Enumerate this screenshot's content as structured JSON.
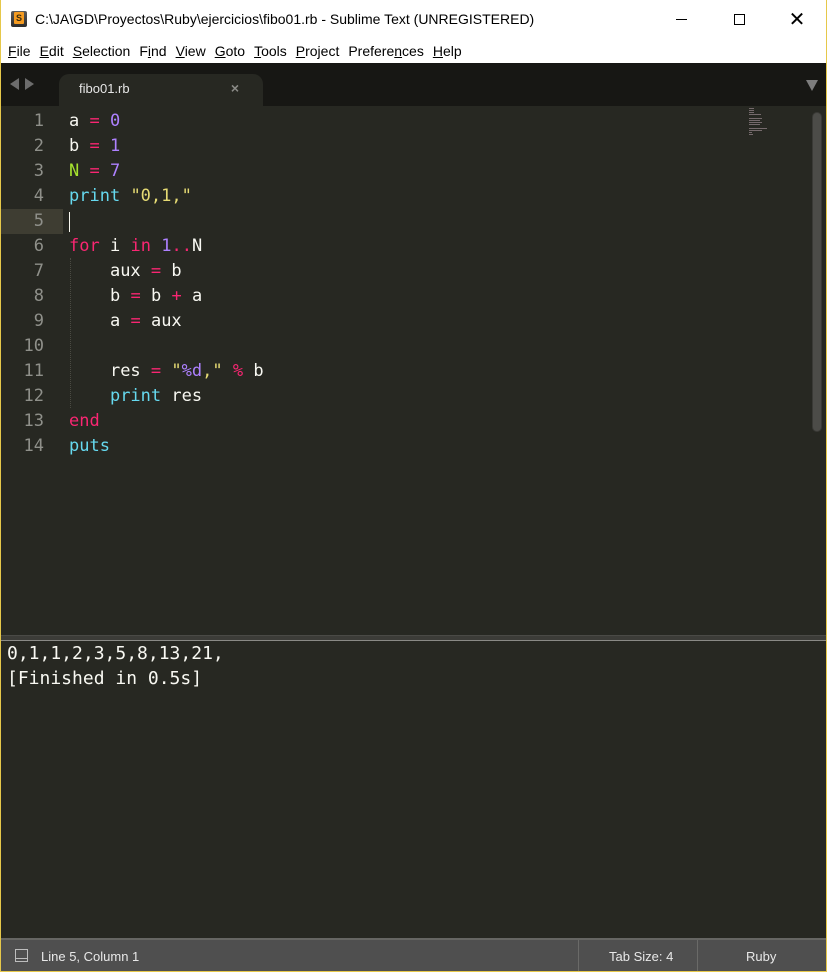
{
  "window": {
    "title": "C:\\JA\\GD\\Proyectos\\Ruby\\ejercicios\\fibo01.rb - Sublime Text (UNREGISTERED)",
    "app_icon_letter": "S",
    "controls": {
      "minimize": "minimize",
      "maximize": "maximize",
      "close": "✕"
    }
  },
  "menu": {
    "items": [
      {
        "label": "File",
        "accel": "F",
        "rest": "ile"
      },
      {
        "label": "Edit",
        "accel": "E",
        "rest": "dit"
      },
      {
        "label": "Selection",
        "accel": "S",
        "rest": "election"
      },
      {
        "label": "Find",
        "pre": "F",
        "accel": "i",
        "rest": "nd"
      },
      {
        "label": "View",
        "accel": "V",
        "rest": "iew"
      },
      {
        "label": "Goto",
        "accel": "G",
        "rest": "oto"
      },
      {
        "label": "Tools",
        "accel": "T",
        "rest": "ools"
      },
      {
        "label": "Project",
        "accel": "P",
        "rest": "roject"
      },
      {
        "label": "Preferences",
        "pre": "Prefere",
        "accel": "n",
        "rest": "ces"
      },
      {
        "label": "Help",
        "accel": "H",
        "rest": "elp"
      }
    ]
  },
  "tabs": {
    "active": {
      "label": "fibo01.rb",
      "close": "×"
    }
  },
  "editor": {
    "current_line": 5,
    "lines": [
      {
        "no": "1",
        "tokens": [
          [
            "var",
            "a"
          ],
          [
            "sp",
            " "
          ],
          [
            "op",
            "="
          ],
          [
            "sp",
            " "
          ],
          [
            "num",
            "0"
          ]
        ]
      },
      {
        "no": "2",
        "tokens": [
          [
            "var",
            "b"
          ],
          [
            "sp",
            " "
          ],
          [
            "op",
            "="
          ],
          [
            "sp",
            " "
          ],
          [
            "num",
            "1"
          ]
        ]
      },
      {
        "no": "3",
        "tokens": [
          [
            "const",
            "N"
          ],
          [
            "sp",
            " "
          ],
          [
            "op",
            "="
          ],
          [
            "sp",
            " "
          ],
          [
            "num",
            "7"
          ]
        ]
      },
      {
        "no": "4",
        "tokens": [
          [
            "fn",
            "print"
          ],
          [
            "sp",
            " "
          ],
          [
            "str",
            "\"0,1,\""
          ]
        ]
      },
      {
        "no": "5",
        "tokens": []
      },
      {
        "no": "6",
        "tokens": [
          [
            "kw",
            "for"
          ],
          [
            "sp",
            " "
          ],
          [
            "var",
            "i"
          ],
          [
            "sp",
            " "
          ],
          [
            "kw",
            "in"
          ],
          [
            "sp",
            " "
          ],
          [
            "num",
            "1"
          ],
          [
            "op",
            ".."
          ],
          [
            "var",
            "N"
          ]
        ]
      },
      {
        "no": "7",
        "tokens": [
          [
            "sp",
            "    "
          ],
          [
            "var",
            "aux"
          ],
          [
            "sp",
            " "
          ],
          [
            "op",
            "="
          ],
          [
            "sp",
            " "
          ],
          [
            "var",
            "b"
          ]
        ]
      },
      {
        "no": "8",
        "tokens": [
          [
            "sp",
            "    "
          ],
          [
            "var",
            "b"
          ],
          [
            "sp",
            " "
          ],
          [
            "op",
            "="
          ],
          [
            "sp",
            " "
          ],
          [
            "var",
            "b"
          ],
          [
            "sp",
            " "
          ],
          [
            "op",
            "+"
          ],
          [
            "sp",
            " "
          ],
          [
            "var",
            "a"
          ]
        ]
      },
      {
        "no": "9",
        "tokens": [
          [
            "sp",
            "    "
          ],
          [
            "var",
            "a"
          ],
          [
            "sp",
            " "
          ],
          [
            "op",
            "="
          ],
          [
            "sp",
            " "
          ],
          [
            "var",
            "aux"
          ]
        ]
      },
      {
        "no": "10",
        "tokens": []
      },
      {
        "no": "11",
        "tokens": [
          [
            "sp",
            "    "
          ],
          [
            "var",
            "res"
          ],
          [
            "sp",
            " "
          ],
          [
            "op",
            "="
          ],
          [
            "sp",
            " "
          ],
          [
            "str",
            "\""
          ],
          [
            "num",
            "%d"
          ],
          [
            "str",
            ",\""
          ],
          [
            "sp",
            " "
          ],
          [
            "op",
            "%"
          ],
          [
            "sp",
            " "
          ],
          [
            "var",
            "b"
          ]
        ]
      },
      {
        "no": "12",
        "tokens": [
          [
            "sp",
            "    "
          ],
          [
            "fn",
            "print"
          ],
          [
            "sp",
            " "
          ],
          [
            "var",
            "res"
          ]
        ]
      },
      {
        "no": "13",
        "tokens": [
          [
            "kw",
            "end"
          ]
        ]
      },
      {
        "no": "14",
        "tokens": [
          [
            "fn",
            "puts"
          ]
        ]
      }
    ]
  },
  "output": {
    "lines": [
      "0,1,1,2,3,5,8,13,21,",
      "[Finished in 0.5s]"
    ]
  },
  "statusbar": {
    "position": "Line 5, Column 1",
    "tab_size": "Tab Size: 4",
    "syntax": "Ruby"
  },
  "colors": {
    "background": "#272822",
    "keyword": "#f92672",
    "number": "#ae81ff",
    "constant": "#a6e22e",
    "function": "#66d9ef",
    "string": "#e6db74",
    "foreground": "#f8f8f2"
  }
}
